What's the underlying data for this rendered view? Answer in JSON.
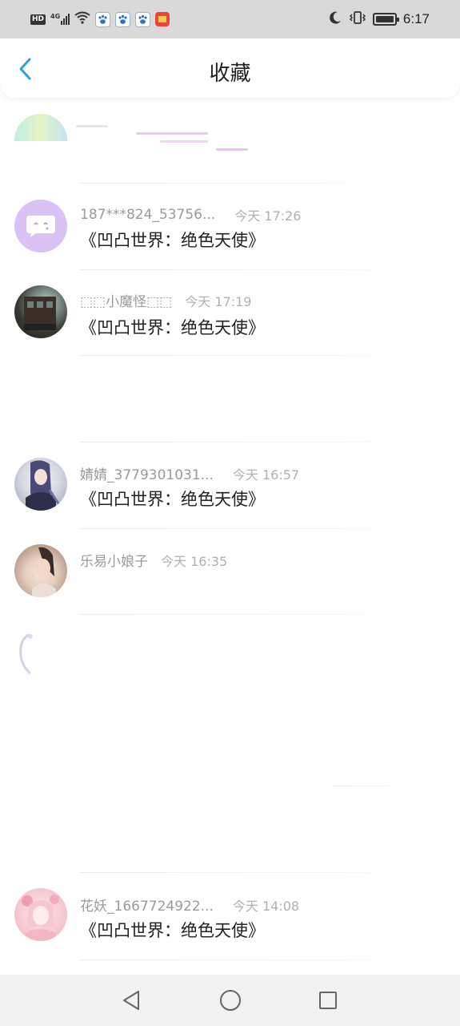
{
  "status_bar": {
    "hd": "HD",
    "network": "4G",
    "time": "6:17"
  },
  "header": {
    "title": "收藏"
  },
  "posts": [
    {
      "user": "187***824_53756...",
      "time": "今天 17:26",
      "text": "《凹凸世界：绝色天使》"
    },
    {
      "user": "⬚⬚小魔怪⬚⬚",
      "time": "今天 17:19",
      "text": "《凹凸世界：绝色天使》"
    },
    {
      "user": "婧婧_3779301031...",
      "time": "今天 16:57",
      "text": "《凹凸世界：绝色天使》"
    },
    {
      "user": "乐易小娘子",
      "time": "今天 16:35"
    },
    {
      "user": "花妖_1667724922...",
      "time": "今天 14:08",
      "text": "《凹凸世界：绝色天使》"
    }
  ],
  "colors": {
    "accent": "#2b9fe8",
    "status_bar_bg": "#d9d9d9",
    "nav_bar_bg": "#f2f2f2",
    "chat_avatar_bg": "#d9c3f5"
  },
  "icons": {
    "back": "chevron-left-icon",
    "nav_back": "triangle-back-icon",
    "nav_home": "circle-home-icon",
    "nav_recent": "square-recent-icon"
  }
}
